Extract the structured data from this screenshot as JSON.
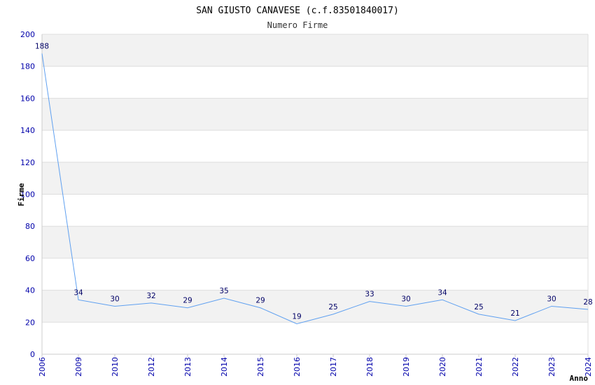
{
  "chart_data": {
    "type": "line",
    "title": "SAN GIUSTO CANAVESE (c.f.83501840017)",
    "subtitle": "Numero Firme",
    "xlabel": "Anno",
    "ylabel": "Firme",
    "categories": [
      "2006",
      "2009",
      "2010",
      "2012",
      "2013",
      "2014",
      "2015",
      "2016",
      "2017",
      "2018",
      "2019",
      "2020",
      "2021",
      "2022",
      "2023",
      "2024"
    ],
    "values": [
      188,
      34,
      30,
      32,
      29,
      35,
      29,
      19,
      25,
      33,
      30,
      34,
      25,
      21,
      30,
      28
    ],
    "data_labels": [
      "188",
      "34",
      "30",
      "32",
      "29",
      "35",
      "29",
      "19",
      "25",
      "33",
      "30",
      "34",
      "25",
      "21",
      "30",
      "28"
    ],
    "ylim": [
      0,
      200
    ],
    "yticks": [
      "0",
      "20",
      "40",
      "60",
      "80",
      "100",
      "120",
      "140",
      "160",
      "180",
      "200"
    ],
    "grid": true,
    "line_color": "#5fa0f0",
    "band_color": "#f2f2f2",
    "grid_color": "#dddddd",
    "tick_color": "#0000aa"
  }
}
